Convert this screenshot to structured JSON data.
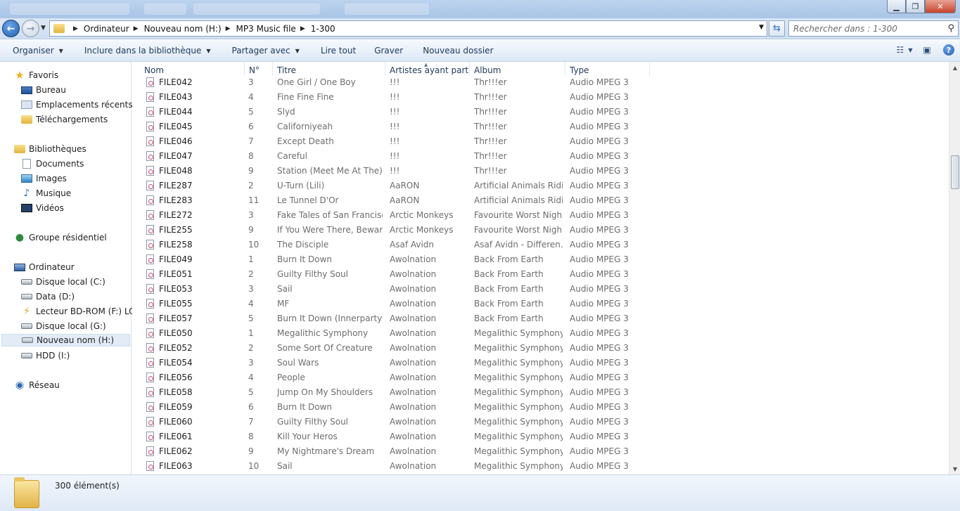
{
  "window": {
    "minimize": "▁",
    "maximize": "❐",
    "close": "✕"
  },
  "address": {
    "crumbs": [
      "Ordinateur",
      "Nouveau nom (H:)",
      "MP3 Music file",
      "1-300"
    ],
    "search_placeholder": "Rechercher dans : 1-300"
  },
  "toolbar": {
    "organize": "Organiser",
    "include_library": "Inclure dans la bibliothèque",
    "share_with": "Partager avec",
    "play_all": "Lire tout",
    "burn": "Graver",
    "new_folder": "Nouveau dossier"
  },
  "nav": {
    "favorites": "Favoris",
    "desktop": "Bureau",
    "recent": "Emplacements récents",
    "downloads": "Téléchargements",
    "libraries": "Bibliothèques",
    "documents": "Documents",
    "images": "Images",
    "music": "Musique",
    "videos": "Vidéos",
    "homegroup": "Groupe résidentiel",
    "computer": "Ordinateur",
    "drive_c": "Disque local (C:)",
    "drive_d": "Data (D:)",
    "drive_f": "Lecteur BD-ROM (F:) LOT",
    "drive_g": "Disque local (G:)",
    "drive_h": "Nouveau nom (H:)",
    "drive_i": "HDD (I:)",
    "network": "Réseau"
  },
  "columns": {
    "name": "Nom",
    "number": "N°",
    "title": "Titre",
    "artists": "Artistes ayant parti...",
    "album": "Album",
    "type": "Type"
  },
  "files": [
    {
      "name": "FILE042",
      "num": "3",
      "title": "One Girl / One Boy",
      "artist": "!!!",
      "album": "Thr!!!er",
      "type": "Audio MPEG 3"
    },
    {
      "name": "FILE043",
      "num": "4",
      "title": "Fine Fine Fine",
      "artist": "!!!",
      "album": "Thr!!!er",
      "type": "Audio MPEG 3"
    },
    {
      "name": "FILE044",
      "num": "5",
      "title": "Slyd",
      "artist": "!!!",
      "album": "Thr!!!er",
      "type": "Audio MPEG 3"
    },
    {
      "name": "FILE045",
      "num": "6",
      "title": "Californiyeah",
      "artist": "!!!",
      "album": "Thr!!!er",
      "type": "Audio MPEG 3"
    },
    {
      "name": "FILE046",
      "num": "7",
      "title": "Except Death",
      "artist": "!!!",
      "album": "Thr!!!er",
      "type": "Audio MPEG 3"
    },
    {
      "name": "FILE047",
      "num": "8",
      "title": "Careful",
      "artist": "!!!",
      "album": "Thr!!!er",
      "type": "Audio MPEG 3"
    },
    {
      "name": "FILE048",
      "num": "9",
      "title": "Station (Meet Me At The)",
      "artist": "!!!",
      "album": "Thr!!!er",
      "type": "Audio MPEG 3"
    },
    {
      "name": "FILE287",
      "num": "2",
      "title": "U-Turn (Lili)",
      "artist": "AaRON",
      "album": "Artificial Animals Ridi...",
      "type": "Audio MPEG 3"
    },
    {
      "name": "FILE283",
      "num": "11",
      "title": "Le Tunnel D'Or",
      "artist": "AaRON",
      "album": "Artificial Animals Ridi...",
      "type": "Audio MPEG 3"
    },
    {
      "name": "FILE272",
      "num": "3",
      "title": "Fake Tales of San Francisco",
      "artist": "Arctic Monkeys",
      "album": "Favourite Worst Nigh...",
      "type": "Audio MPEG 3"
    },
    {
      "name": "FILE255",
      "num": "9",
      "title": "If You Were There, Beware",
      "artist": "Arctic Monkeys",
      "album": "Favourite Worst Nigh...",
      "type": "Audio MPEG 3"
    },
    {
      "name": "FILE258",
      "num": "10",
      "title": "The Disciple",
      "artist": "Asaf Avidn",
      "album": "Asaf Avidn - Differen...",
      "type": "Audio MPEG 3"
    },
    {
      "name": "FILE049",
      "num": "1",
      "title": "Burn It Down",
      "artist": "Awolnation",
      "album": "Back From Earth",
      "type": "Audio MPEG 3"
    },
    {
      "name": "FILE051",
      "num": "2",
      "title": "Guilty Filthy Soul",
      "artist": "Awolnation",
      "album": "Back From Earth",
      "type": "Audio MPEG 3"
    },
    {
      "name": "FILE053",
      "num": "3",
      "title": "Sail",
      "artist": "Awolnation",
      "album": "Back From Earth",
      "type": "Audio MPEG 3"
    },
    {
      "name": "FILE055",
      "num": "4",
      "title": "MF",
      "artist": "Awolnation",
      "album": "Back From Earth",
      "type": "Audio MPEG 3"
    },
    {
      "name": "FILE057",
      "num": "5",
      "title": "Burn It Down (Innerpartys...",
      "artist": "Awolnation",
      "album": "Back From Earth",
      "type": "Audio MPEG 3"
    },
    {
      "name": "FILE050",
      "num": "1",
      "title": "Megalithic Symphony",
      "artist": "Awolnation",
      "album": "Megalithic Symphony",
      "type": "Audio MPEG 3"
    },
    {
      "name": "FILE052",
      "num": "2",
      "title": "Some Sort Of Creature",
      "artist": "Awolnation",
      "album": "Megalithic Symphony",
      "type": "Audio MPEG 3"
    },
    {
      "name": "FILE054",
      "num": "3",
      "title": "Soul Wars",
      "artist": "Awolnation",
      "album": "Megalithic Symphony",
      "type": "Audio MPEG 3"
    },
    {
      "name": "FILE056",
      "num": "4",
      "title": "People",
      "artist": "Awolnation",
      "album": "Megalithic Symphony",
      "type": "Audio MPEG 3"
    },
    {
      "name": "FILE058",
      "num": "5",
      "title": "Jump On My Shoulders",
      "artist": "Awolnation",
      "album": "Megalithic Symphony",
      "type": "Audio MPEG 3"
    },
    {
      "name": "FILE059",
      "num": "6",
      "title": "Burn It Down",
      "artist": "Awolnation",
      "album": "Megalithic Symphony",
      "type": "Audio MPEG 3"
    },
    {
      "name": "FILE060",
      "num": "7",
      "title": "Guilty Filthy Soul",
      "artist": "Awolnation",
      "album": "Megalithic Symphony",
      "type": "Audio MPEG 3"
    },
    {
      "name": "FILE061",
      "num": "8",
      "title": "Kill Your Heros",
      "artist": "Awolnation",
      "album": "Megalithic Symphony",
      "type": "Audio MPEG 3"
    },
    {
      "name": "FILE062",
      "num": "9",
      "title": "My Nightmare's Dream",
      "artist": "Awolnation",
      "album": "Megalithic Symphony",
      "type": "Audio MPEG 3"
    },
    {
      "name": "FILE063",
      "num": "10",
      "title": "Sail",
      "artist": "Awolnation",
      "album": "Megalithic Symphony",
      "type": "Audio MPEG 3"
    }
  ],
  "status": {
    "count": "300 élément(s)"
  },
  "colors": {
    "accent": "#1f5fae",
    "toolbar_text": "#1e395b",
    "selected_nav": "#e3ebf6"
  }
}
